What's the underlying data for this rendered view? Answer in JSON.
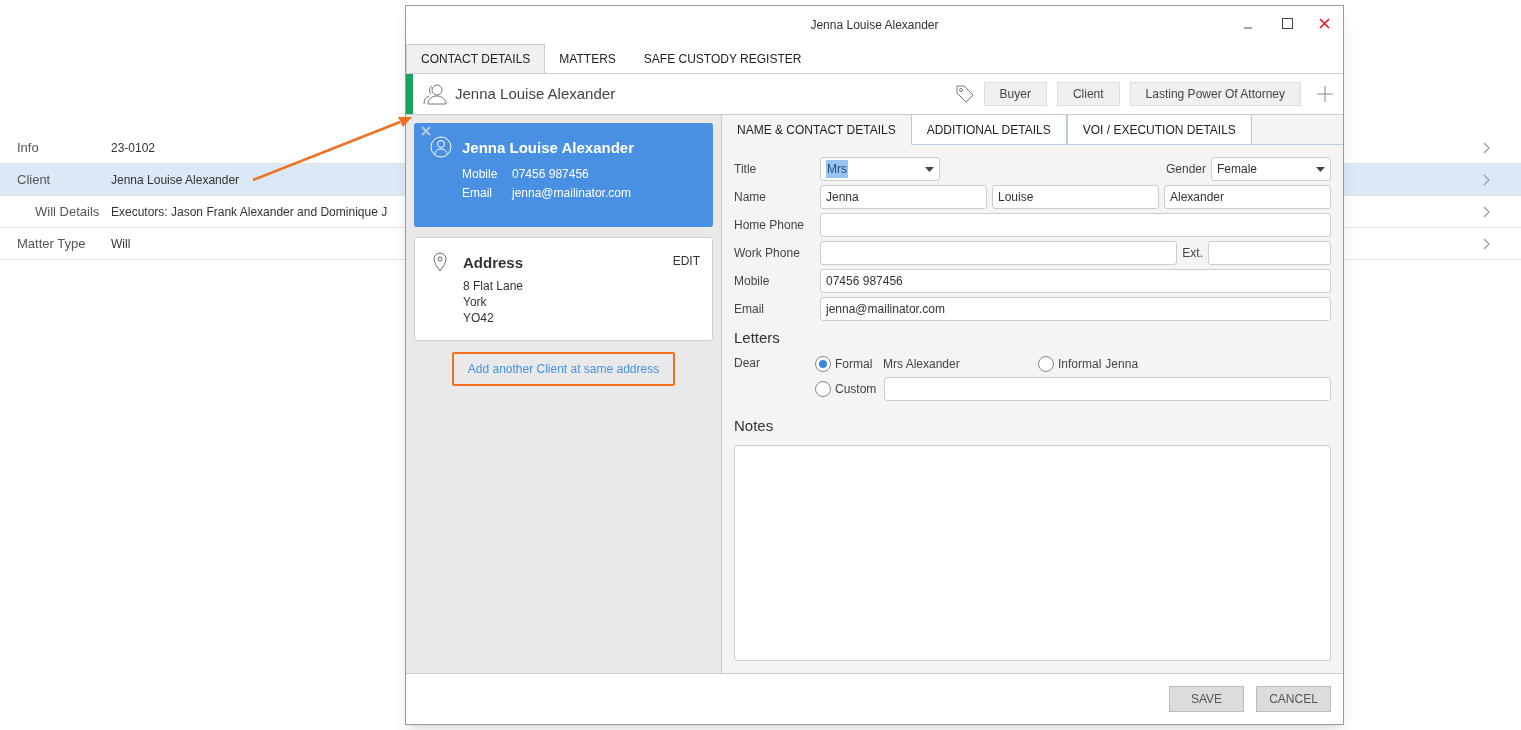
{
  "background_list": {
    "rows": [
      {
        "label": "Info",
        "value": "23-0102",
        "selected": false,
        "children": []
      },
      {
        "label": "Client",
        "value": "Jenna Louise Alexander",
        "selected": true,
        "children": [
          {
            "label": "Will Details",
            "value": "Executors: Jason Frank Alexander and Dominique J",
            "selected": false
          }
        ]
      },
      {
        "label": "Matter Type",
        "value": "Will",
        "selected": false,
        "children": []
      }
    ]
  },
  "window": {
    "title": "Jenna Louise Alexander"
  },
  "tabs": [
    {
      "label": "CONTACT DETAILS",
      "selected": true
    },
    {
      "label": "MATTERS",
      "selected": false
    },
    {
      "label": "SAFE CUSTODY REGISTER",
      "selected": false
    }
  ],
  "header": {
    "name": "Jenna Louise Alexander",
    "tags": [
      "Buyer",
      "Client",
      "Lasting Power Of Attorney"
    ]
  },
  "client_card": {
    "name": "Jenna Louise Alexander",
    "fields": [
      {
        "label": "Mobile",
        "value": "07456 987456"
      },
      {
        "label": "Email",
        "value": "jenna@mailinator.com"
      }
    ]
  },
  "address_card": {
    "title": "Address",
    "lines": [
      "8 Flat Lane",
      "York",
      "YO42"
    ],
    "edit": "EDIT"
  },
  "add_link": "Add another Client at same address",
  "form_tabs": [
    {
      "label": "NAME & CONTACT DETAILS",
      "selected": true
    },
    {
      "label": "ADDITIONAL DETAILS",
      "selected": false
    },
    {
      "label": "VOI / EXECUTION DETAILS",
      "selected": false
    }
  ],
  "form": {
    "title": {
      "label": "Title",
      "value": "Mrs",
      "highlighted": true
    },
    "gender": {
      "label": "Gender",
      "value": "Female"
    },
    "name": {
      "label": "Name",
      "values": [
        "Jenna",
        "Louise",
        "Alexander"
      ]
    },
    "home_phone": {
      "label": "Home Phone"
    },
    "work_phone": {
      "label": "Work Phone",
      "ext_label": "Ext."
    },
    "mobile": {
      "label": "Mobile",
      "value": "07456 987456"
    },
    "email": {
      "label": "Email",
      "value": "jenna@mailinator.com"
    }
  },
  "letters": {
    "heading": "Letters",
    "dear_label": "Dear",
    "options": [
      {
        "label": "Formal",
        "text": "Mrs Alexander",
        "selected": true
      },
      {
        "label": "Informal",
        "text": "Jenna",
        "selected": false
      },
      {
        "label": "Custom",
        "selected": false
      }
    ]
  },
  "notes": {
    "heading": "Notes"
  },
  "buttons": [
    "SAVE",
    "CANCEL"
  ]
}
